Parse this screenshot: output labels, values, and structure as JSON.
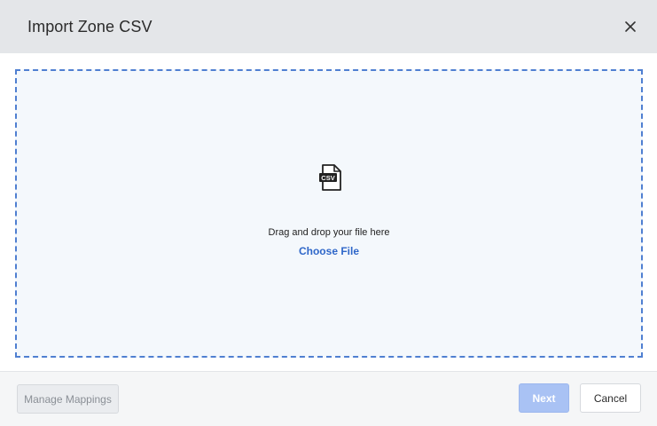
{
  "dialog": {
    "title": "Import Zone CSV",
    "close_icon": "close-icon"
  },
  "dropzone": {
    "icon": "csv-file-icon",
    "icon_label": "CSV",
    "instruction": "Drag and drop your file here",
    "choose_file_label": "Choose File"
  },
  "footer": {
    "manage_mappings_label": "Manage Mappings",
    "next_label": "Next",
    "cancel_label": "Cancel"
  },
  "colors": {
    "header_bg": "#e4e6e9",
    "dropzone_border": "#4f7fd1",
    "dropzone_bg": "#f4f8fc",
    "link": "#2f67c9",
    "next_disabled_bg": "#a9c2f4"
  }
}
